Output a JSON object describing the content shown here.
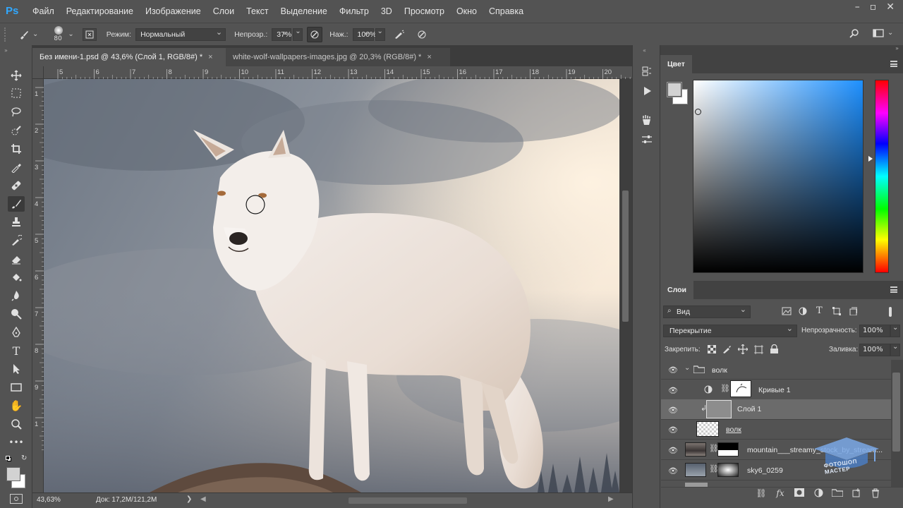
{
  "app": {
    "logo": "Ps"
  },
  "menu": [
    "Файл",
    "Редактирование",
    "Изображение",
    "Слои",
    "Текст",
    "Выделение",
    "Фильтр",
    "3D",
    "Просмотр",
    "Окно",
    "Справка"
  ],
  "options": {
    "brush_size": "80",
    "mode_label": "Режим:",
    "mode_value": "Нормальный",
    "opacity_label": "Непрозр.:",
    "opacity_value": "37%",
    "flow_label": "Наж.:",
    "flow_value": "100%"
  },
  "tabs": [
    {
      "label": "Без имени-1.psd @ 43,6% (Слой 1, RGB/8#) *",
      "close": "×"
    },
    {
      "label": "white-wolf-wallpapers-images.jpg @ 20,3% (RGB/8#) *",
      "close": "×"
    }
  ],
  "ruler": {
    "h": [
      "5",
      "6",
      "7",
      "8",
      "9",
      "10",
      "11",
      "12",
      "13",
      "14",
      "15",
      "16",
      "17",
      "18",
      "19",
      "20"
    ],
    "v": [
      "1",
      "2",
      "3",
      "4",
      "5",
      "6",
      "7",
      "8",
      "9",
      "1"
    ]
  },
  "status": {
    "zoom": "43,63%",
    "doc": "Док: 17,2M/121,2M",
    "arrow": "❯"
  },
  "color_panel": {
    "title": "Цвет",
    "hue_fraction": 0.41
  },
  "layers_panel": {
    "title": "Слои",
    "filter_value": "Вид",
    "blend_mode": "Перекрытие",
    "opacity_label": "Непрозрачность:",
    "opacity_value": "100%",
    "lock_label": "Закрепить:",
    "fill_label": "Заливка:",
    "fill_value": "100%",
    "layers": [
      {
        "name": "волк",
        "type": "group"
      },
      {
        "name": "Кривые 1",
        "type": "adjustment"
      },
      {
        "name": "Слой 1",
        "type": "layer",
        "selected": true
      },
      {
        "name": "волк",
        "type": "layer"
      },
      {
        "name": "mountain___streamy_stock_by_stream...",
        "type": "layer"
      },
      {
        "name": "sky6_0259",
        "type": "layer"
      }
    ]
  },
  "watermark": "ФОТОШОП МАСТЕР",
  "colors": {
    "ps_blue": "#31a8ff",
    "panel": "#535353",
    "dark": "#282828"
  }
}
